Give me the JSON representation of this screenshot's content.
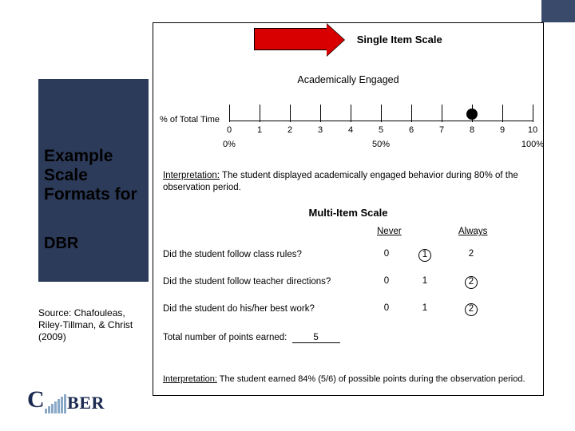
{
  "title_text": "Example Scale Formats for",
  "dbr": "DBR",
  "source": "Source: Chafouleas, Riley-Tillman, & Christ (2009)",
  "sis_title": "Single Item Scale",
  "ae_label": "Academically Engaged",
  "y_label": "% of Total Time",
  "ticks": [
    "0",
    "1",
    "2",
    "3",
    "4",
    "5",
    "6",
    "7",
    "8",
    "9",
    "10"
  ],
  "marked_tick": 8,
  "pcts": {
    "p0": "0%",
    "p50": "50%",
    "p100": "100%"
  },
  "interp_label": "Interpretation:",
  "interp_text": " The student displayed academically engaged behavior during 80% of the observation period.",
  "mis_title": "Multi-Item Scale",
  "never": "Never",
  "always": "Always",
  "questions": [
    {
      "text": "Did the student follow class rules?",
      "v": [
        "0",
        "1",
        "2"
      ],
      "circled": 1
    },
    {
      "text": "Did the student follow teacher directions?",
      "v": [
        "0",
        "1",
        "2"
      ],
      "circled": 2
    },
    {
      "text": "Did the student do his/her best work?",
      "v": [
        "0",
        "1",
        "2"
      ],
      "circled": 2
    }
  ],
  "total_label": "Total number of points earned:",
  "total_value": "5",
  "interp2_label": "Interpretation:",
  "interp2_text": " The student earned 84% (5/6) of possible points during the observation period.",
  "logo_text_1": "C",
  "logo_text_2": "BER",
  "chart_data": {
    "type": "table",
    "single_item_scale": {
      "label": "Academically Engaged",
      "axis": "% of Total Time",
      "range": [
        0,
        10
      ],
      "anchors": {
        "0": "0%",
        "5": "50%",
        "10": "100%"
      },
      "selected_value": 8,
      "selected_percent": 80
    },
    "multi_item_scale": {
      "columns": [
        "Never",
        null,
        "Always"
      ],
      "option_values": [
        0,
        1,
        2
      ],
      "items": [
        {
          "prompt": "Did the student follow class rules?",
          "score": 1
        },
        {
          "prompt": "Did the student follow teacher directions?",
          "score": 2
        },
        {
          "prompt": "Did the student do his/her best work?",
          "score": 2
        }
      ],
      "total_points": 5,
      "max_points": 6,
      "percent": 84
    }
  }
}
